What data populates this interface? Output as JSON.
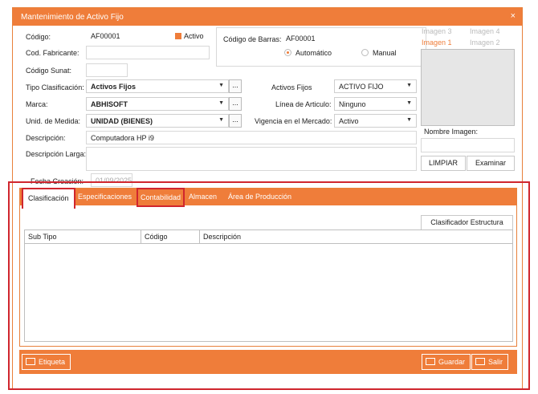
{
  "window": {
    "title": "Mantenimiento de Activo Fijo",
    "close_glyph": "×"
  },
  "form": {
    "codigo_label": "Código:",
    "codigo_value": "AF00001",
    "activo_label": "Activo",
    "cod_fabricante_label": "Cod. Fabricante:",
    "codigo_sunat_label": "Código Sunat:",
    "tipo_clasificacion_label": "Tipo Clasificación:",
    "tipo_clasificacion_value": "Activos Fijos",
    "marca_label": "Marca:",
    "marca_value": "ABHISOFT",
    "unid_medida_label": "Unid. de Medida:",
    "unid_medida_value": "UNIDAD (BIENES)",
    "descripcion_label": "Descripción:",
    "descripcion_value": "Computadora HP i9",
    "descripcion_larga_label": "Descripción Larga:",
    "fecha_creacion_label": "Fecha Creación:",
    "fecha_creacion_value": "01/09/2025",
    "dots": "..."
  },
  "barcode": {
    "label": "Código de Barras:",
    "value": "AF00001",
    "automatico_label": "Automático",
    "manual_label": "Manual"
  },
  "right_fields": {
    "activos_fijos_label": "Activos Fijos",
    "activos_fijos_value": "ACTIVO FIJO",
    "linea_label": "Línea de Articulo:",
    "linea_value": "Ninguno",
    "vigencia_label": "Vigencia en el Mercado:",
    "vigencia_value": "Activo"
  },
  "images": {
    "tabs": [
      "Imagen 3",
      "Imagen 4",
      "Imagen 1",
      "Imagen 2"
    ],
    "nombre_label": "Nombre Imagen:",
    "limpiar_label": "LIMPIAR",
    "examinar_label": "Examinar"
  },
  "tabs": [
    "Clasificación",
    "Especificaciones",
    "Contabilidad",
    "Almacen",
    "Área de Producción"
  ],
  "clasificacion": {
    "estructura_button": "Clasificador Estructura",
    "columns": [
      "Sub Tipo",
      "Código",
      "Descripción"
    ]
  },
  "footer": {
    "etiqueta_label": "Etiqueta",
    "guardar_label": "Guardar",
    "salir_label": "Salir"
  },
  "colors": {
    "accent": "#ef7d3a",
    "highlight": "#d0262e"
  }
}
